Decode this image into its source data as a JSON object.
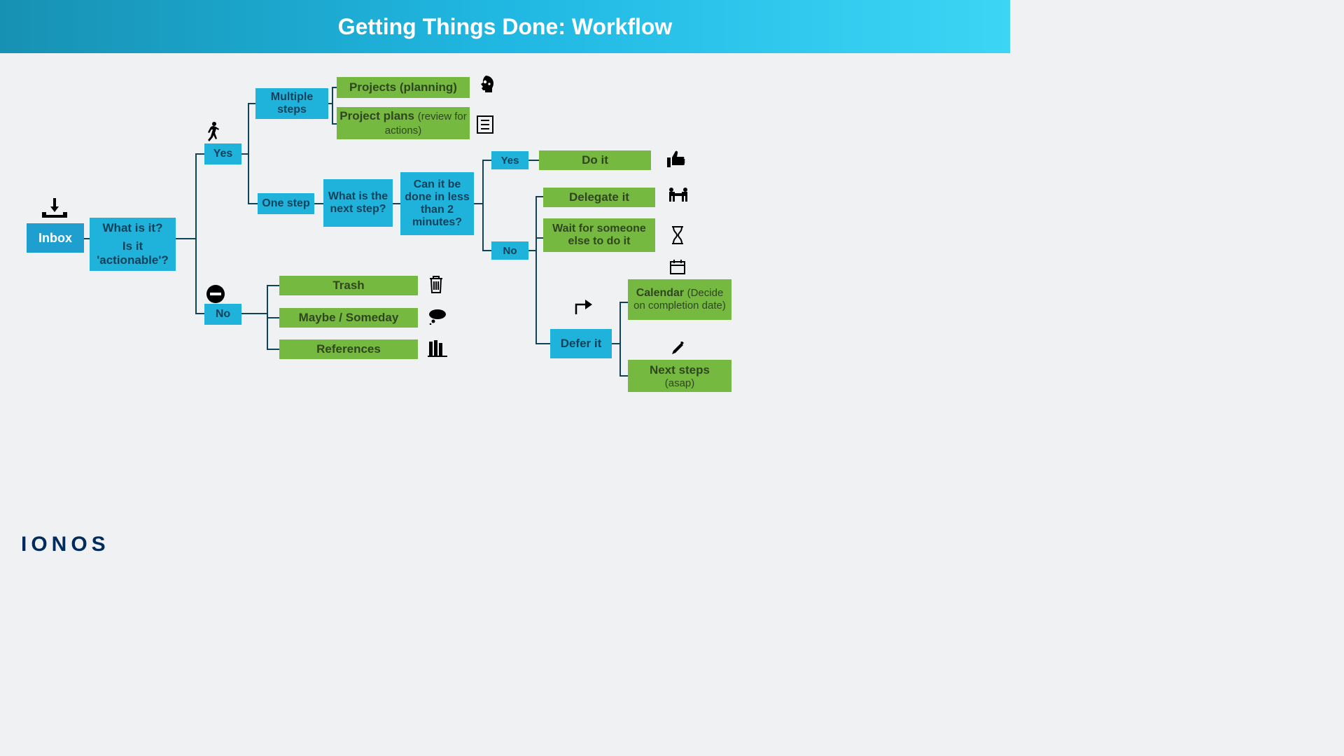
{
  "header": {
    "title": "Getting Things Done: Workflow"
  },
  "logo": "IONOS",
  "nodes": {
    "inbox": "Inbox",
    "what_is_it_l1": "What is it?",
    "what_is_it_l2": "Is it 'actionable'?",
    "yes_action": "Yes",
    "no_action": "No",
    "multiple_steps": "Multiple steps",
    "one_step": "One step",
    "projects_planning": "Projects (planning)",
    "project_plans_main": "Project plans ",
    "project_plans_sub": "(review for actions)",
    "next_step_q": "What is the next step?",
    "two_min_q": "Can it be done in less than 2 minutes?",
    "yes_2min": "Yes",
    "no_2min": "No",
    "do_it": "Do it",
    "delegate_it": "Delegate it",
    "wait_someone": "Wait for someone else to do it",
    "defer_it": "Defer it",
    "calendar_main": "Calendar ",
    "calendar_sub": "(Decide on completion date)",
    "next_steps_main": "Next steps",
    "next_steps_sub": "(asap)",
    "trash": "Trash",
    "maybe_someday": "Maybe / Someday",
    "references": "References"
  },
  "icons": {
    "walk": "walking-person-icon",
    "stop": "stop-sign-icon",
    "brain": "head-gears-icon",
    "checklist": "checklist-icon",
    "trash": "trash-icon",
    "cloud": "thought-cloud-icon",
    "books": "books-icon",
    "thumbs": "thumbs-up-icon",
    "meeting": "meeting-icon",
    "hourglass": "hourglass-icon",
    "calendar": "calendar-icon",
    "share": "share-arrow-icon",
    "pencil": "pencil-icon",
    "inbox": "inbox-tray-icon"
  }
}
